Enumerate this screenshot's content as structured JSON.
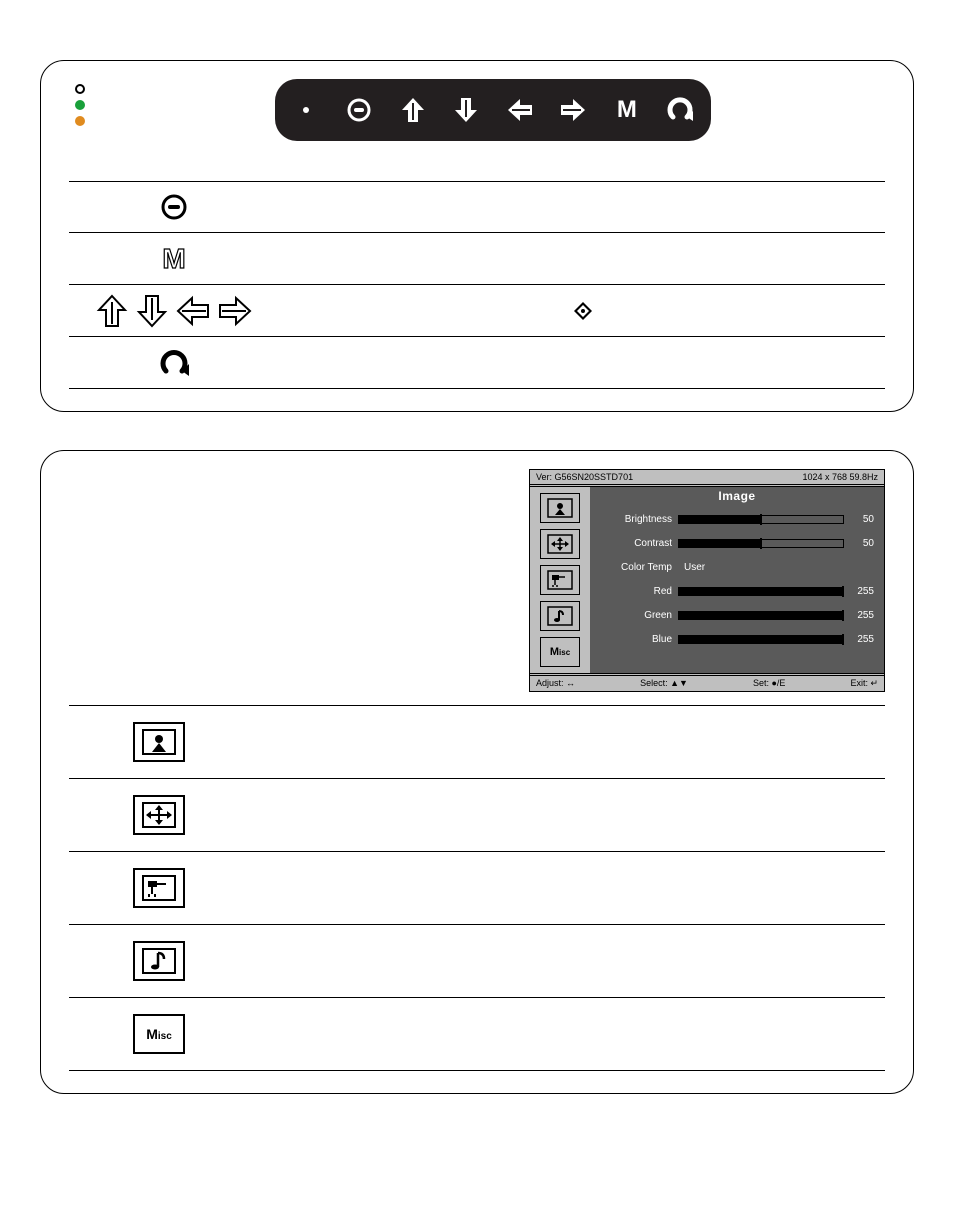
{
  "panel1": {
    "keys": [
      "power-dot",
      "power-ring",
      "up",
      "down",
      "left",
      "right",
      "menu",
      "return"
    ],
    "rows": [
      {
        "icons": [
          "power-ring"
        ],
        "text": ""
      },
      {
        "icons": [
          "menu"
        ],
        "text": ""
      },
      {
        "icons": [
          "up",
          "down",
          "left",
          "right"
        ],
        "mid_glyph": "diamond",
        "text": ""
      },
      {
        "icons": [
          "return"
        ],
        "text": ""
      }
    ]
  },
  "osd": {
    "ver_label": "Ver:",
    "ver": "G56SN20SSTD701",
    "mode": "1024 x 768  59.8Hz",
    "tabs": [
      "image",
      "geometry",
      "signal",
      "audio",
      "misc"
    ],
    "title": "Image",
    "items": [
      {
        "label": "Brightness",
        "type": "slider",
        "value": 50,
        "max": 100
      },
      {
        "label": "Contrast",
        "type": "slider",
        "value": 50,
        "max": 100
      },
      {
        "label": "Color Temp",
        "type": "text",
        "text": "User"
      },
      {
        "label": "Red",
        "type": "slider",
        "value": 255,
        "max": 255
      },
      {
        "label": "Green",
        "type": "slider",
        "value": 255,
        "max": 255
      },
      {
        "label": "Blue",
        "type": "slider",
        "value": 255,
        "max": 255
      }
    ],
    "hints": {
      "adjust": "Adjust: ↔",
      "select": "Select: ▲▼",
      "set": "Set: ●/E",
      "exit": "Exit: ↵"
    }
  },
  "panel2_rows": [
    "image",
    "geometry",
    "signal",
    "audio",
    "misc"
  ]
}
